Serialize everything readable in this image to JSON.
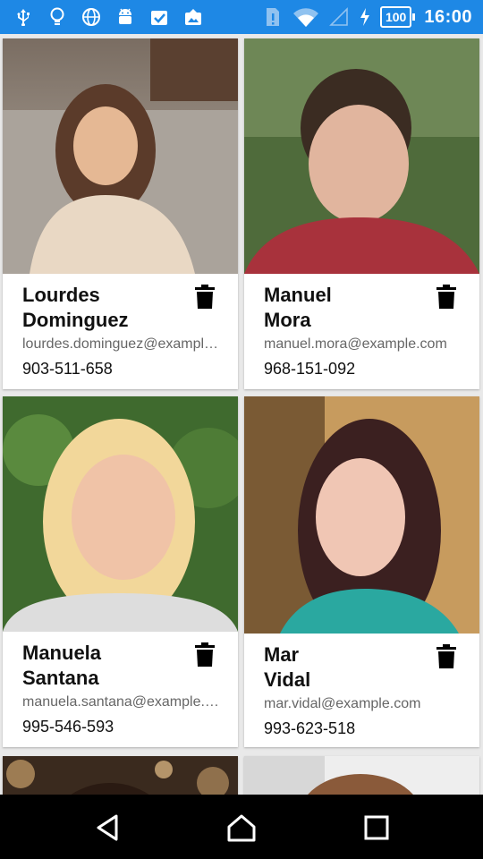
{
  "status_bar": {
    "time": "16:00",
    "battery": "100",
    "left_icons": [
      "usb-icon",
      "lightbulb-icon",
      "globe-icon",
      "android-icon",
      "check-clipboard-icon",
      "photo-upload-icon"
    ],
    "right_icons": [
      "sim-alert-icon",
      "wifi-icon",
      "signal-icon",
      "charging-icon"
    ]
  },
  "contacts": [
    {
      "first": "Lourdes",
      "last": "Dominguez",
      "email": "lourdes.dominguez@example.com",
      "phone": "903-511-658",
      "photo_colors": [
        "#8b6a4f",
        "#e9d8c4",
        "#5b3b2a"
      ]
    },
    {
      "first": "Manuel",
      "last": "Mora",
      "email": "manuel.mora@example.com",
      "phone": "968-151-092",
      "photo_colors": [
        "#4f6b3b",
        "#a8323c",
        "#e1b59e"
      ]
    },
    {
      "first": "Manuela",
      "last": "Santana",
      "email": "manuela.santana@example.com",
      "phone": "995-546-593",
      "photo_colors": [
        "#3f6a2e",
        "#f2d79a",
        "#f0c3a7"
      ]
    },
    {
      "first": "Mar",
      "last": "Vidal",
      "email": "mar.vidal@example.com",
      "phone": "993-623-518",
      "photo_colors": [
        "#c79b5e",
        "#3b2020",
        "#f0c6b4"
      ]
    },
    {
      "first": "",
      "last": "",
      "email": "",
      "phone": "",
      "photo_colors": [
        "#3a2a1e",
        "#c8a06a",
        "#2a1a12"
      ]
    },
    {
      "first": "",
      "last": "",
      "email": "",
      "phone": "",
      "photo_colors": [
        "#eeeeee",
        "#d7d7d7",
        "#8a5a3a"
      ]
    }
  ],
  "nav": {
    "icons": [
      "back-icon",
      "home-icon",
      "recents-icon"
    ]
  }
}
